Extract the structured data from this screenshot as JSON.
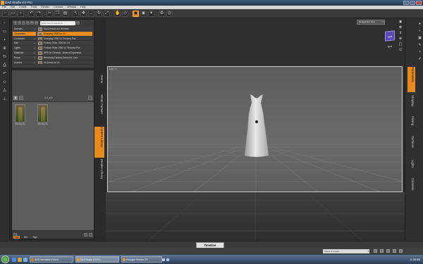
{
  "window": {
    "title": "DAZ Studio 4.5 Pro"
  },
  "menu": [
    "File",
    "Edit",
    "Create",
    "Tools",
    "Render",
    "Connect",
    "Window",
    "Help"
  ],
  "toolbar_icons": [
    "new-file-icon",
    "open-file-icon",
    "save-icon",
    "undo-icon",
    "redo-icon",
    "cut-icon",
    "copy-icon",
    "paste-icon",
    "node-selection-icon",
    "universal-tool-icon",
    "translate-icon",
    "rotate-icon",
    "scale-icon",
    "pose-tool-icon",
    "geometry-tool-icon",
    "spot-render-icon",
    "camera-icon",
    "light-icon",
    "render-settings-icon",
    "render-icon"
  ],
  "content_library": {
    "search_placeholder": "Enter text to search by",
    "categories": [
      {
        "label": "Animals",
        "selected": false
      },
      {
        "label": "Characters",
        "selected": true
      },
      {
        "label": "Costumes",
        "selected": false
      },
      {
        "label": "Hair",
        "selected": false
      },
      {
        "label": "Lights",
        "selected": false
      },
      {
        "label": "Materials",
        "selected": false
      },
      {
        "label": "Props",
        "selected": false
      },
      {
        "label": "Scenes",
        "selected": false
      }
    ],
    "products": [
      {
        "label": "Day Dresses for Genesis",
        "selected": false
      },
      {
        "label": "Everyday 1930 for V4",
        "selected": true
      },
      {
        "label": "Everyday 1930 V4 Textures Pac",
        "selected": false
      },
      {
        "label": "Fortune Teller 1930 for V4",
        "selected": false
      },
      {
        "label": "Fortune Teller 1930 V4 Textured Pac",
        "selected": false
      },
      {
        "label": "MFD for Genesis - Arsenal Expansion",
        "selected": false
      },
      {
        "label": "Revolving Fantasy Dress for Luna",
        "selected": false
      },
      {
        "label": "V4 Dress for V4",
        "selected": false
      }
    ],
    "page_indicator": "1-2 of 2",
    "tiles": [
      {
        "caption": "1930 Day Everyday"
      },
      {
        "caption": "1930 Day Dress"
      }
    ],
    "bottom_tabs": [
      {
        "label": "Tags",
        "selected": true
      },
      {
        "label": "Info",
        "selected": false
      },
      {
        "label": "Tags",
        "selected": false
      }
    ]
  },
  "left_tabs": [
    {
      "label": "Scene",
      "selected": false
    },
    {
      "label": "Smart Content",
      "selected": false
    },
    {
      "label": "Content Library",
      "selected": true
    },
    {
      "label": "Render Library",
      "selected": false
    }
  ],
  "viewport": {
    "camera": "Perspective View",
    "cube_label": "Right Back",
    "canvas_label": "1.00 : 1"
  },
  "right_tabs": [
    {
      "label": "Parameters",
      "selected": true
    },
    {
      "label": "Shaping",
      "selected": false
    },
    {
      "label": "Posing",
      "selected": false
    },
    {
      "label": "Surfaces",
      "selected": false
    },
    {
      "label": "Lights",
      "selected": false
    },
    {
      "label": "Cameras",
      "selected": false
    }
  ],
  "timeline": {
    "label": "Timeline"
  },
  "status": {
    "lesson_placeholder": "Select a Lesson..."
  },
  "taskbar": {
    "tasks": [
      {
        "label": "DAZ Discussion Forum...",
        "color": "#d67a2a",
        "active": false
      },
      {
        "label": "DAZ Studio 4.5 Pro",
        "color": "#f0a020",
        "active": true
      },
      {
        "label": "Hexagon Version 2.5",
        "color": "#c9a640",
        "active": false
      }
    ],
    "clock": "11:38 AM"
  },
  "colors": {
    "accent": "#e98a1c",
    "taskbar": "#3a5270"
  }
}
